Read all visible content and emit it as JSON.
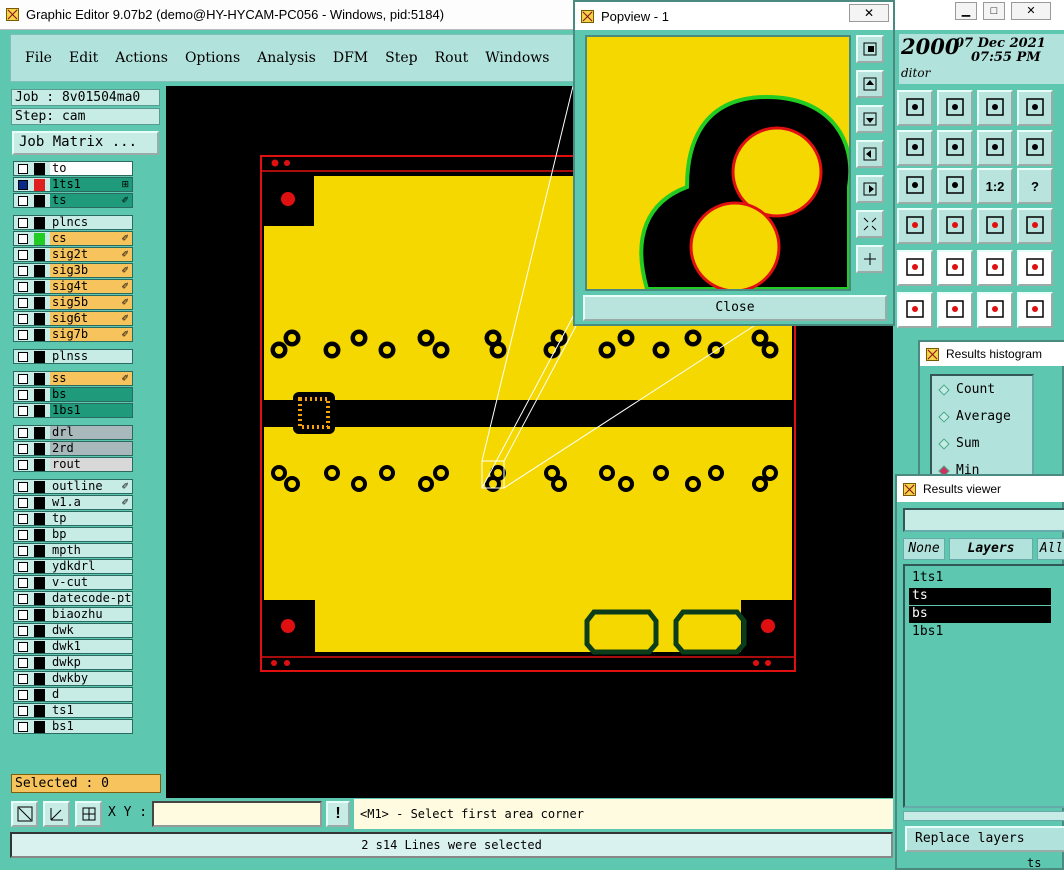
{
  "main_window": {
    "title": "Graphic Editor 9.07b2 (demo@HY-HYCAM-PC056 - Windows, pid:5184)",
    "menu": [
      "File",
      "Edit",
      "Actions",
      "Options",
      "Analysis",
      "DFM",
      "Step",
      "Rout",
      "Windows"
    ]
  },
  "left_panel": {
    "job": "Job : 8v01504ma0",
    "step": "Step: cam",
    "job_matrix_button": "Job Matrix ...",
    "selected": "Selected : 0",
    "layers": [
      {
        "name": "to",
        "bg": "#ffffff",
        "chip": "",
        "mark": ""
      },
      {
        "name": "1ts1",
        "bg": "#1f9a7a",
        "chip": "#e02020",
        "mark": "⊞",
        "checked": true
      },
      {
        "name": "ts",
        "bg": "#1f9a7a",
        "chip": "",
        "mark": "✐"
      },
      {
        "name": "plncs",
        "bg": "#c7ece6",
        "chip": "",
        "mark": ""
      },
      {
        "name": "cs",
        "bg": "#f7c35d",
        "chip": "#22cc22",
        "mark": "✐"
      },
      {
        "name": "sig2t",
        "bg": "#f7c35d",
        "chip": "",
        "mark": "✐"
      },
      {
        "name": "sig3b",
        "bg": "#f7c35d",
        "chip": "",
        "mark": "✐"
      },
      {
        "name": "sig4t",
        "bg": "#f7c35d",
        "chip": "",
        "mark": "✐"
      },
      {
        "name": "sig5b",
        "bg": "#f7c35d",
        "chip": "",
        "mark": "✐"
      },
      {
        "name": "sig6t",
        "bg": "#f7c35d",
        "chip": "",
        "mark": "✐"
      },
      {
        "name": "sig7b",
        "bg": "#f7c35d",
        "chip": "",
        "mark": "✐"
      },
      {
        "name": "plnss",
        "bg": "#c7ece6",
        "chip": "",
        "mark": ""
      },
      {
        "name": "ss",
        "bg": "#f7c35d",
        "chip": "",
        "mark": "✐"
      },
      {
        "name": "bs",
        "bg": "#1f9a7a",
        "chip": "",
        "mark": ""
      },
      {
        "name": "1bs1",
        "bg": "#1f9a7a",
        "chip": "",
        "mark": ""
      },
      {
        "name": "drl",
        "bg": "#a9b9bb",
        "chip": "",
        "mark": ""
      },
      {
        "name": "2rd",
        "bg": "#a9b9bb",
        "chip": "",
        "mark": ""
      },
      {
        "name": "rout",
        "bg": "#d8d8d8",
        "chip": "",
        "mark": ""
      },
      {
        "name": "outline",
        "bg": "#c7ece6",
        "chip": "",
        "mark": "✐"
      },
      {
        "name": "w1.a",
        "bg": "#c7ece6",
        "chip": "",
        "mark": "✐"
      },
      {
        "name": "tp",
        "bg": "#c7ece6",
        "chip": "",
        "mark": ""
      },
      {
        "name": "bp",
        "bg": "#c7ece6",
        "chip": "",
        "mark": ""
      },
      {
        "name": "mpth",
        "bg": "#c7ece6",
        "chip": "",
        "mark": ""
      },
      {
        "name": "ydkdrl",
        "bg": "#c7ece6",
        "chip": "",
        "mark": ""
      },
      {
        "name": "v-cut",
        "bg": "#c7ece6",
        "chip": "",
        "mark": ""
      },
      {
        "name": "datecode-pt",
        "bg": "#c7ece6",
        "chip": "",
        "mark": ""
      },
      {
        "name": "biaozhu",
        "bg": "#c7ece6",
        "chip": "",
        "mark": ""
      },
      {
        "name": "dwk",
        "bg": "#c7ece6",
        "chip": "",
        "mark": ""
      },
      {
        "name": "dwk1",
        "bg": "#c7ece6",
        "chip": "",
        "mark": ""
      },
      {
        "name": "dwkp",
        "bg": "#c7ece6",
        "chip": "",
        "mark": ""
      },
      {
        "name": "dwkby",
        "bg": "#c7ece6",
        "chip": "",
        "mark": ""
      },
      {
        "name": "d",
        "bg": "#c7ece6",
        "chip": "",
        "mark": ""
      },
      {
        "name": "ts1",
        "bg": "#c7ece6",
        "chip": "",
        "mark": ""
      },
      {
        "name": "bs1",
        "bg": "#c7ece6",
        "chip": "",
        "mark": ""
      }
    ]
  },
  "bottom": {
    "xy_label": "X Y :",
    "xy_value": "",
    "prompt": "<M1> - Select first area corner",
    "status": "2 s14 Lines were selected"
  },
  "clock": {
    "year": "2000",
    "date": "07 Dec 2021",
    "time": "07:55 PM",
    "sub": "ditor"
  },
  "right_tools": {
    "labels": [
      "1:2",
      "?"
    ]
  },
  "popview": {
    "title": "Popview - 1",
    "close_label": "Close"
  },
  "histogram": {
    "title": "Results histogram",
    "options": [
      "Count",
      "Average",
      "Sum",
      "Min"
    ]
  },
  "results_viewer": {
    "title": "Results viewer",
    "tabs": [
      "None",
      "Layers",
      "All"
    ],
    "items": [
      {
        "name": "1ts1",
        "selected": false
      },
      {
        "name": "ts",
        "selected": true
      },
      {
        "name": "bs",
        "selected": true
      },
      {
        "name": "1bs1",
        "selected": false
      }
    ],
    "replace_button": "Replace layers",
    "footer": "ts"
  },
  "colors": {
    "panel": "#5ec7b0",
    "copper": "#f5d800",
    "outline": "#e01010",
    "highlight": "#22cc22"
  }
}
